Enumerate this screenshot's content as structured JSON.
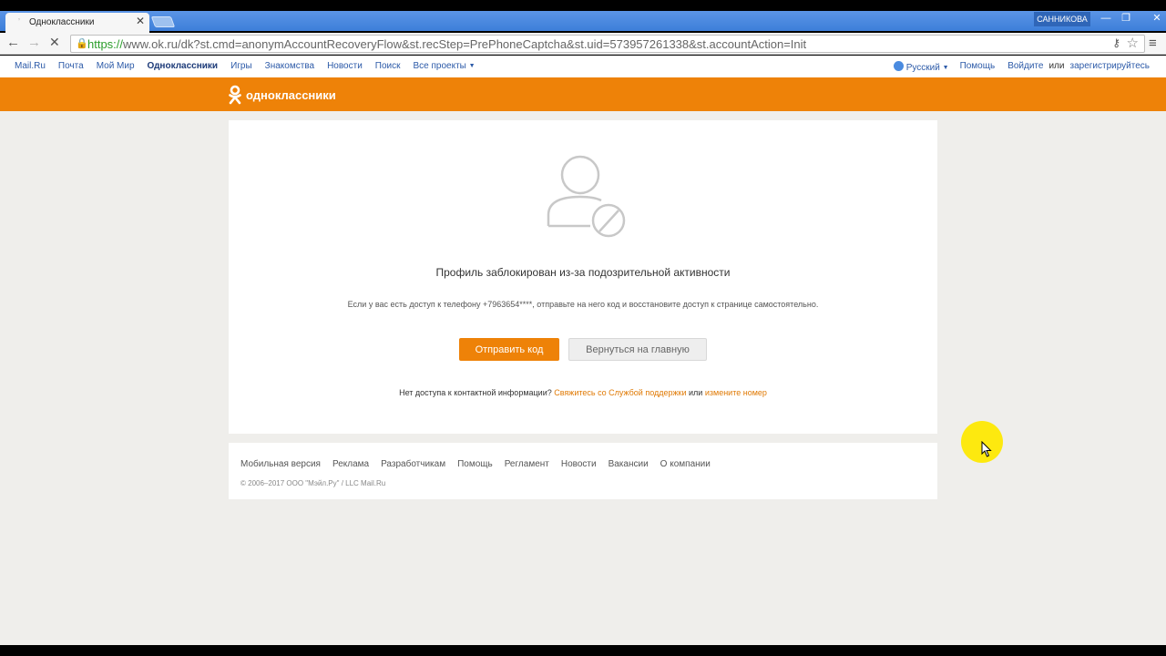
{
  "browser": {
    "tab_title": "Одноклассники",
    "tab_close": "✕",
    "user_name": "САННИКОВА",
    "url_scheme": "https://",
    "url_rest": "www.ok.ru/dk?st.cmd=anonymAccountRecoveryFlow&st.recStep=PrePhoneCaptcha&st.uid=573957261338&st.accountAction=Init",
    "back_icon": "←",
    "forward_icon": "→",
    "reload_icon": "✕",
    "menu_icon": "≡"
  },
  "portal": {
    "links": [
      "Mail.Ru",
      "Почта",
      "Мой Мир",
      "Одноклассники",
      "Игры",
      "Знакомства",
      "Новости",
      "Поиск",
      "Все проекты"
    ],
    "language": "Русский",
    "help": "Помощь",
    "login": "Войдите",
    "or": "или",
    "register": "зарегистрируйтесь"
  },
  "header": {
    "logo_text": "одноклассники",
    "brand_color": "#ee8208"
  },
  "card": {
    "title": "Профиль заблокирован из-за подозрительной активности",
    "text": "Если у вас есть доступ к телефону +7963654****, отправьте на него код и восстановите доступ к странице самостоятельно.",
    "send_code": "Отправить код",
    "home": "Вернуться на главную",
    "no_access_text": "Нет доступа к контактной информации?",
    "support_link": "Свяжитесь со Службой поддержки",
    "or": "или",
    "change_number": "измените номер"
  },
  "footer": {
    "links": [
      "Мобильная версия",
      "Реклама",
      "Разработчикам",
      "Помощь",
      "Регламент",
      "Новости",
      "Вакансии",
      "О компании"
    ],
    "copyright": "© 2006–2017 ООО \"Мэйл.Ру\" / LLC Mail.Ru"
  }
}
